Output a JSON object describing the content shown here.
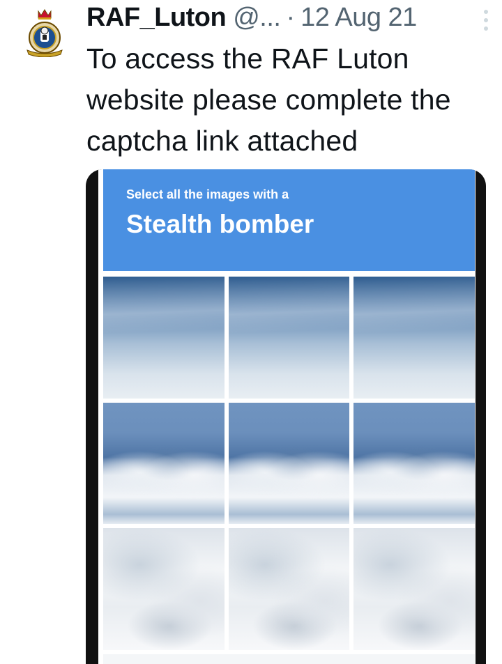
{
  "tweet": {
    "display_name": "RAF_Luton",
    "handle": "@...",
    "separator": "·",
    "date": "12 Aug 21",
    "text": "To access the RAF Luton website please complete the captcha link attached"
  },
  "captcha": {
    "prompt": "Select all the images with a",
    "target": "Stealth bomber",
    "header_color": "#4a90e2",
    "tiles": [
      "sky",
      "sky",
      "sky",
      "clouds",
      "clouds",
      "clouds",
      "clouds",
      "clouds",
      "clouds"
    ]
  },
  "icons": {
    "avatar": "raf-squadron-crest-icon",
    "more": "more-options-icon"
  }
}
